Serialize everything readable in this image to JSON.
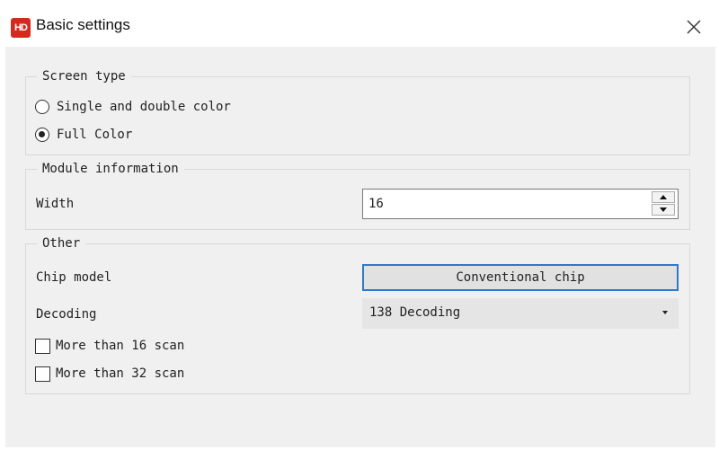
{
  "window": {
    "app_logo_text": "HD",
    "title": "Basic settings"
  },
  "screen_type": {
    "legend": "Screen type",
    "options": [
      {
        "label": "Single and double color",
        "checked": false
      },
      {
        "label": "Full Color",
        "checked": true
      }
    ]
  },
  "module_info": {
    "legend": "Module information",
    "width_label": "Width",
    "width_value": "16"
  },
  "other": {
    "legend": "Other",
    "chip_model_label": "Chip model",
    "chip_model_button": "Conventional chip",
    "decoding_label": "Decoding",
    "decoding_value": "138 Decoding",
    "checkboxes": [
      {
        "label": "More than 16 scan",
        "checked": false
      },
      {
        "label": "More than 32 scan",
        "checked": false
      }
    ]
  },
  "colors": {
    "accent": "#2f78c8",
    "logo": "#d42a1e",
    "panel_bg": "#f0f0f0"
  }
}
